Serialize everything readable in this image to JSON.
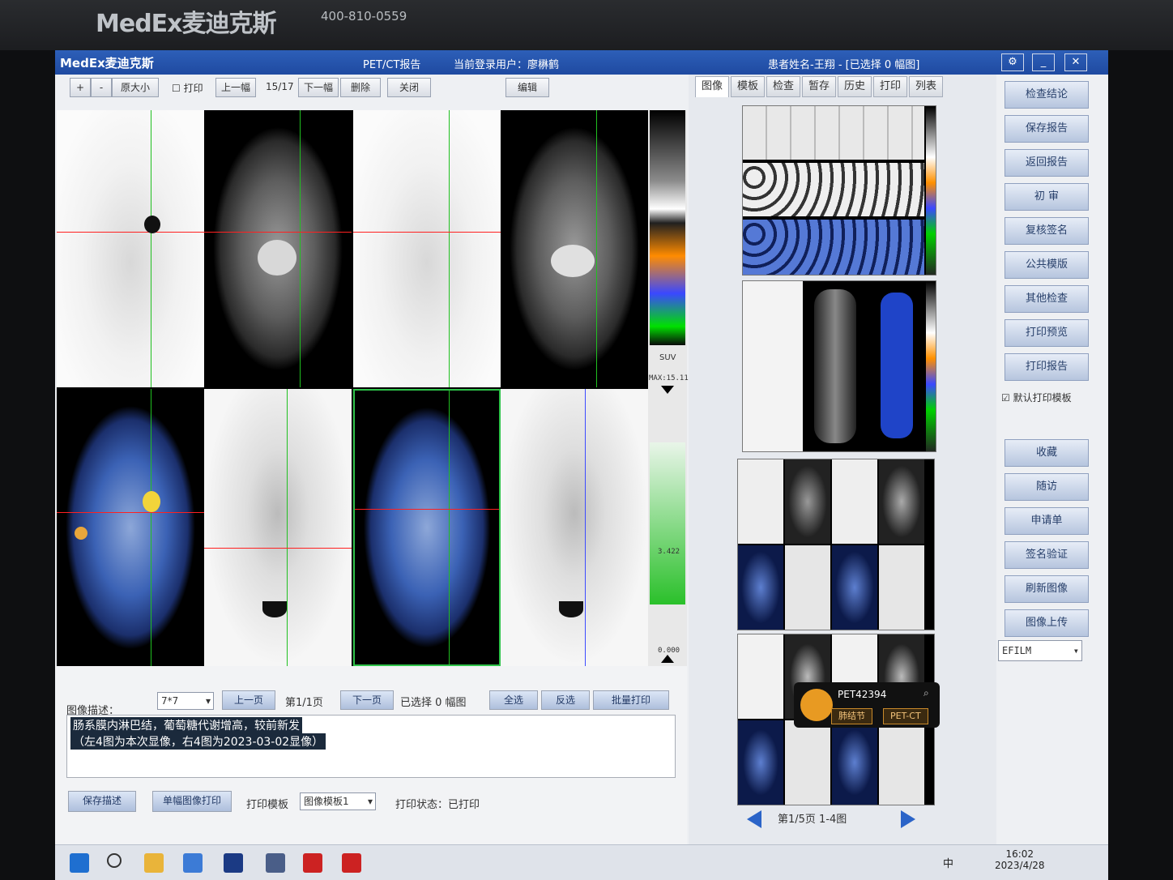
{
  "monitor": {
    "brand": "MedEx麦迪克斯",
    "phone": "400-810-0559"
  },
  "titlebar": {
    "logo": "MedEx麦迪克斯",
    "module": "PET/CT报告",
    "user": "当前登录用户：廖楙鹤",
    "patient": "患者姓名-王翔 - [已选择 0 幅图]",
    "settings_icon": "gear-icon",
    "min_label": "_",
    "close_label": "✕"
  },
  "toolbar": {
    "zoom_in": "+",
    "zoom_out": "-",
    "original_size": "原大小",
    "print_check": "打印",
    "prev_frame": "上一幅",
    "frame_counter": "15/17",
    "next_frame": "下一幅",
    "delete": "删除",
    "close": "关闭",
    "edit": "编辑"
  },
  "colorbar": {
    "suv_label": "SUV",
    "max_label": "MAX:15.11",
    "mid_label": "3.422",
    "min_label": "0.000"
  },
  "bottom": {
    "desc_label": "图像描述：",
    "layout_value": "7*7",
    "prev_page": "上一页",
    "page_info": "第1/1页",
    "next_page": "下一页",
    "selected_info": "已选择 0 幅图",
    "select_all": "全选",
    "invert": "反选",
    "batch_print": "批量打印",
    "desc_line1": "肠系膜内淋巴结，葡萄糖代谢增高，较前新发",
    "desc_line2": "（左4图为本次显像，右4图为2023-03-02显像）",
    "save_desc": "保存描述",
    "single_print": "单幅图像打印",
    "print_template_label": "打印模板",
    "print_template_value": "图像模板1",
    "print_status": "打印状态：已打印"
  },
  "tabs": [
    "图像",
    "模板",
    "检查",
    "暂存",
    "历史",
    "打印",
    "列表"
  ],
  "thumb_pager": "第1/5页 1-4图",
  "popup": {
    "id": "PET42394",
    "tag1": "肺结节",
    "tag2": "PET-CT"
  },
  "side_buttons": [
    "检查结论",
    "保存报告",
    "返回报告",
    "初 审",
    "复核签名",
    "公共模版",
    "其他检查",
    "打印预览",
    "打印报告"
  ],
  "default_template_check": "默认打印模板",
  "side_buttons2": [
    "收藏",
    "随访",
    "申请单",
    "签名验证",
    "刷新图像",
    "图像上传"
  ],
  "efilm_value": "EFILM",
  "taskbar": {
    "time": "16:02",
    "date": "2023/4/28",
    "ime": "中"
  },
  "colors": {
    "title_bar": "#1f4aa1",
    "accent_green": "#2ac02a",
    "crosshair_red": "#ff2020",
    "crosshair_green": "#20c020"
  }
}
